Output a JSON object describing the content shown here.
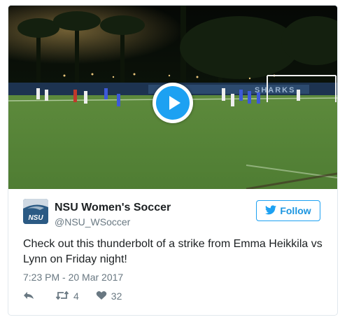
{
  "media": {
    "type": "video",
    "play_icon": "play-icon",
    "billboard_text": "SHARKS"
  },
  "author": {
    "name": "NSU Women's Soccer",
    "handle": "@NSU_WSoccer",
    "avatar_text": "NSU"
  },
  "follow": {
    "label": "Follow",
    "icon": "twitter-bird-icon",
    "color": "#1da1f2"
  },
  "tweet": {
    "text": "Check out this thunderbolt of a strike from Emma Heikkila vs Lynn on Friday night!",
    "timestamp": "7:23 PM - 20 Mar 2017"
  },
  "actions": {
    "reply_icon": "reply-icon",
    "retweet_icon": "retweet-icon",
    "retweet_count": "4",
    "like_icon": "heart-icon",
    "like_count": "32"
  }
}
